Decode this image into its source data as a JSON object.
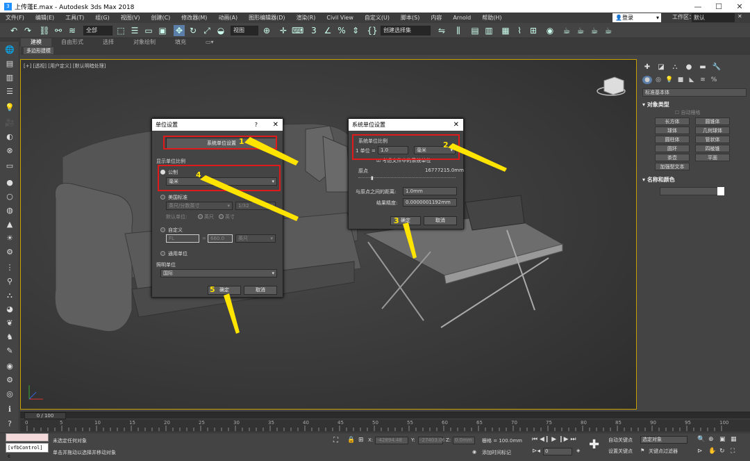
{
  "window": {
    "title": "上传蓬E.max - Autodesk 3ds Max 2018",
    "app_icon": "3"
  },
  "menu": {
    "items": [
      "文件(F)",
      "编辑(E)",
      "工具(T)",
      "组(G)",
      "视图(V)",
      "创建(C)",
      "修改器(M)",
      "动画(A)",
      "图形编辑器(D)",
      "渲染(R)",
      "Civil View",
      "自定义(U)",
      "脚本(S)",
      "内容",
      "Arnold",
      "帮助(H)"
    ],
    "login": "登录",
    "workspace_label": "工作区：",
    "workspace_value": "默认"
  },
  "toolbar": {
    "filter": "全部",
    "view_ref": "视图",
    "selection_set": "创建选择集"
  },
  "ribbon": {
    "tabs": [
      "建模",
      "自由形式",
      "选择",
      "对象绘制",
      "填充"
    ],
    "subtab": "多边形建模"
  },
  "viewport": {
    "label": "[+] [透视] [用户定义] [默认明暗处理]"
  },
  "cmdpanel": {
    "dropdown": "标准基本体",
    "rollout_object_type": "对象类型",
    "autogrid": "自动栅格",
    "objects": [
      "长方体",
      "圆锥体",
      "球体",
      "几何球体",
      "圆柱体",
      "管状体",
      "圆环",
      "四棱锥",
      "茶壶",
      "平面",
      "加强型文本"
    ],
    "rollout_name_color": "名称和颜色"
  },
  "dialog_units": {
    "title": "单位设置",
    "help": "?",
    "system_unit_btn": "系统单位设置",
    "display_scale": "显示单位比例",
    "metric": "公制",
    "metric_value": "毫米",
    "us_standard": "美国标准",
    "us_value": "英尺/分数英寸",
    "us_fraction": "1/32",
    "default_unit": "默认单位:",
    "feet": "英尺",
    "inch": "英寸",
    "custom": "自定义",
    "custom_name": "FL",
    "custom_value": "660.0",
    "custom_unit": "英尺",
    "generic": "通用单位",
    "lighting": "照明单位",
    "lighting_value": "国际",
    "ok": "确定",
    "cancel": "取消"
  },
  "dialog_system": {
    "title": "系统单位设置",
    "scale_group": "系统单位比例",
    "unit_prefix": "1 单位 =",
    "unit_value": "1.0",
    "unit_type": "毫米",
    "respect_files": "考虑文件中的系统单位",
    "origin": "原点",
    "origin_value": "16777215.0mm",
    "distance_label": "与原点之间的距离:",
    "distance_value": "1.0mm",
    "precision_label": "结果精度:",
    "precision_value": "0.0000001192mm",
    "ok": "确定",
    "cancel": "取消"
  },
  "annotations": [
    "1",
    "2",
    "3",
    "4",
    "5"
  ],
  "timeline": {
    "frame": "0 / 100",
    "ticks": [
      "0",
      "5",
      "10",
      "15",
      "20",
      "25",
      "30",
      "35",
      "40",
      "45",
      "50",
      "55",
      "60",
      "65",
      "70",
      "75",
      "80",
      "85",
      "90",
      "95",
      "100"
    ]
  },
  "status": {
    "selection": "未选定任何对象",
    "hint": "单击并拖动以选择并移动对象",
    "maxscript": "[vfbControl] c",
    "x_label": "X:",
    "x_value": "-42894.48",
    "y_label": "Y:",
    "y_value": "-27403.06",
    "z_label": "Z:",
    "z_value": "0.0mm",
    "grid": "栅格 = 100.0mm",
    "add_time_tag": "添加时间标记",
    "autokey": "自动关键点",
    "selected": "选定对象",
    "set_key": "设置关键点",
    "key_filters": "关键点过滤器",
    "frame_value": "0"
  }
}
